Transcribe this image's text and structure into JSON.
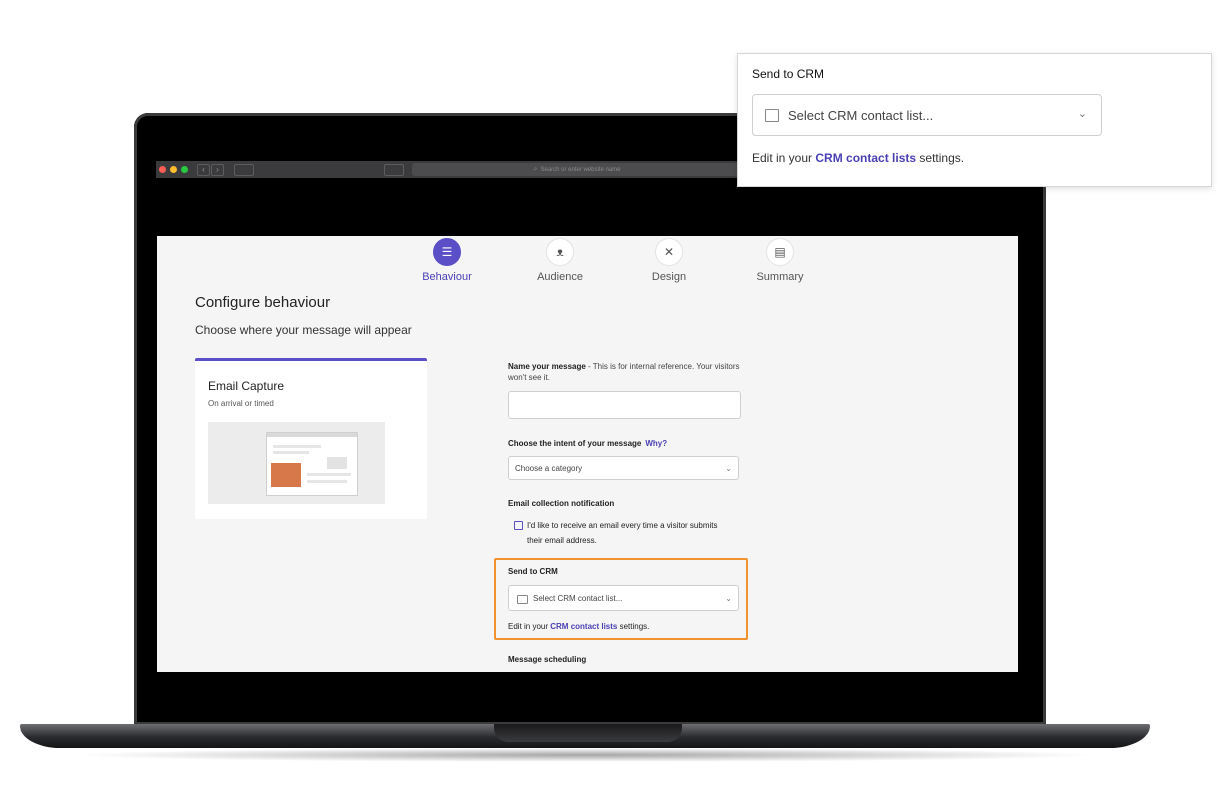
{
  "browser": {
    "address_placeholder": "Search or enter website name"
  },
  "steps": [
    {
      "label": "Behaviour",
      "icon": "list-icon",
      "active": true
    },
    {
      "label": "Audience",
      "icon": "audience-icon",
      "active": false
    },
    {
      "label": "Design",
      "icon": "design-tools-icon",
      "active": false
    },
    {
      "label": "Summary",
      "icon": "summary-icon",
      "active": false
    }
  ],
  "page": {
    "title": "Configure behaviour",
    "subtitle": "Choose where your message will appear"
  },
  "card": {
    "title": "Email Capture",
    "subtitle": "On arrival or timed"
  },
  "form": {
    "name_label": "Name your message",
    "name_hint": " - This is for internal reference. Your visitors won't see it.",
    "name_value": "",
    "intent_label": "Choose the intent of your message",
    "intent_why": "Why?",
    "intent_selected": "Choose a category",
    "notification_label": "Email collection notification",
    "notification_option": "I'd like to receive an email every time a visitor submits their email address.",
    "notification_checked": false,
    "crm_label": "Send to CRM",
    "crm_placeholder": "Select CRM contact list...",
    "crm_help_prefix": "Edit in your ",
    "crm_help_link": "CRM contact lists",
    "crm_help_suffix": " settings.",
    "scheduling_label": "Message scheduling"
  },
  "callout": {
    "title": "Send to CRM",
    "placeholder": "Select CRM contact list...",
    "help_prefix": "Edit in your ",
    "help_link": "CRM contact lists",
    "help_suffix": " settings."
  },
  "colors": {
    "accent": "#5a4fc6",
    "highlight": "#f0922e"
  }
}
